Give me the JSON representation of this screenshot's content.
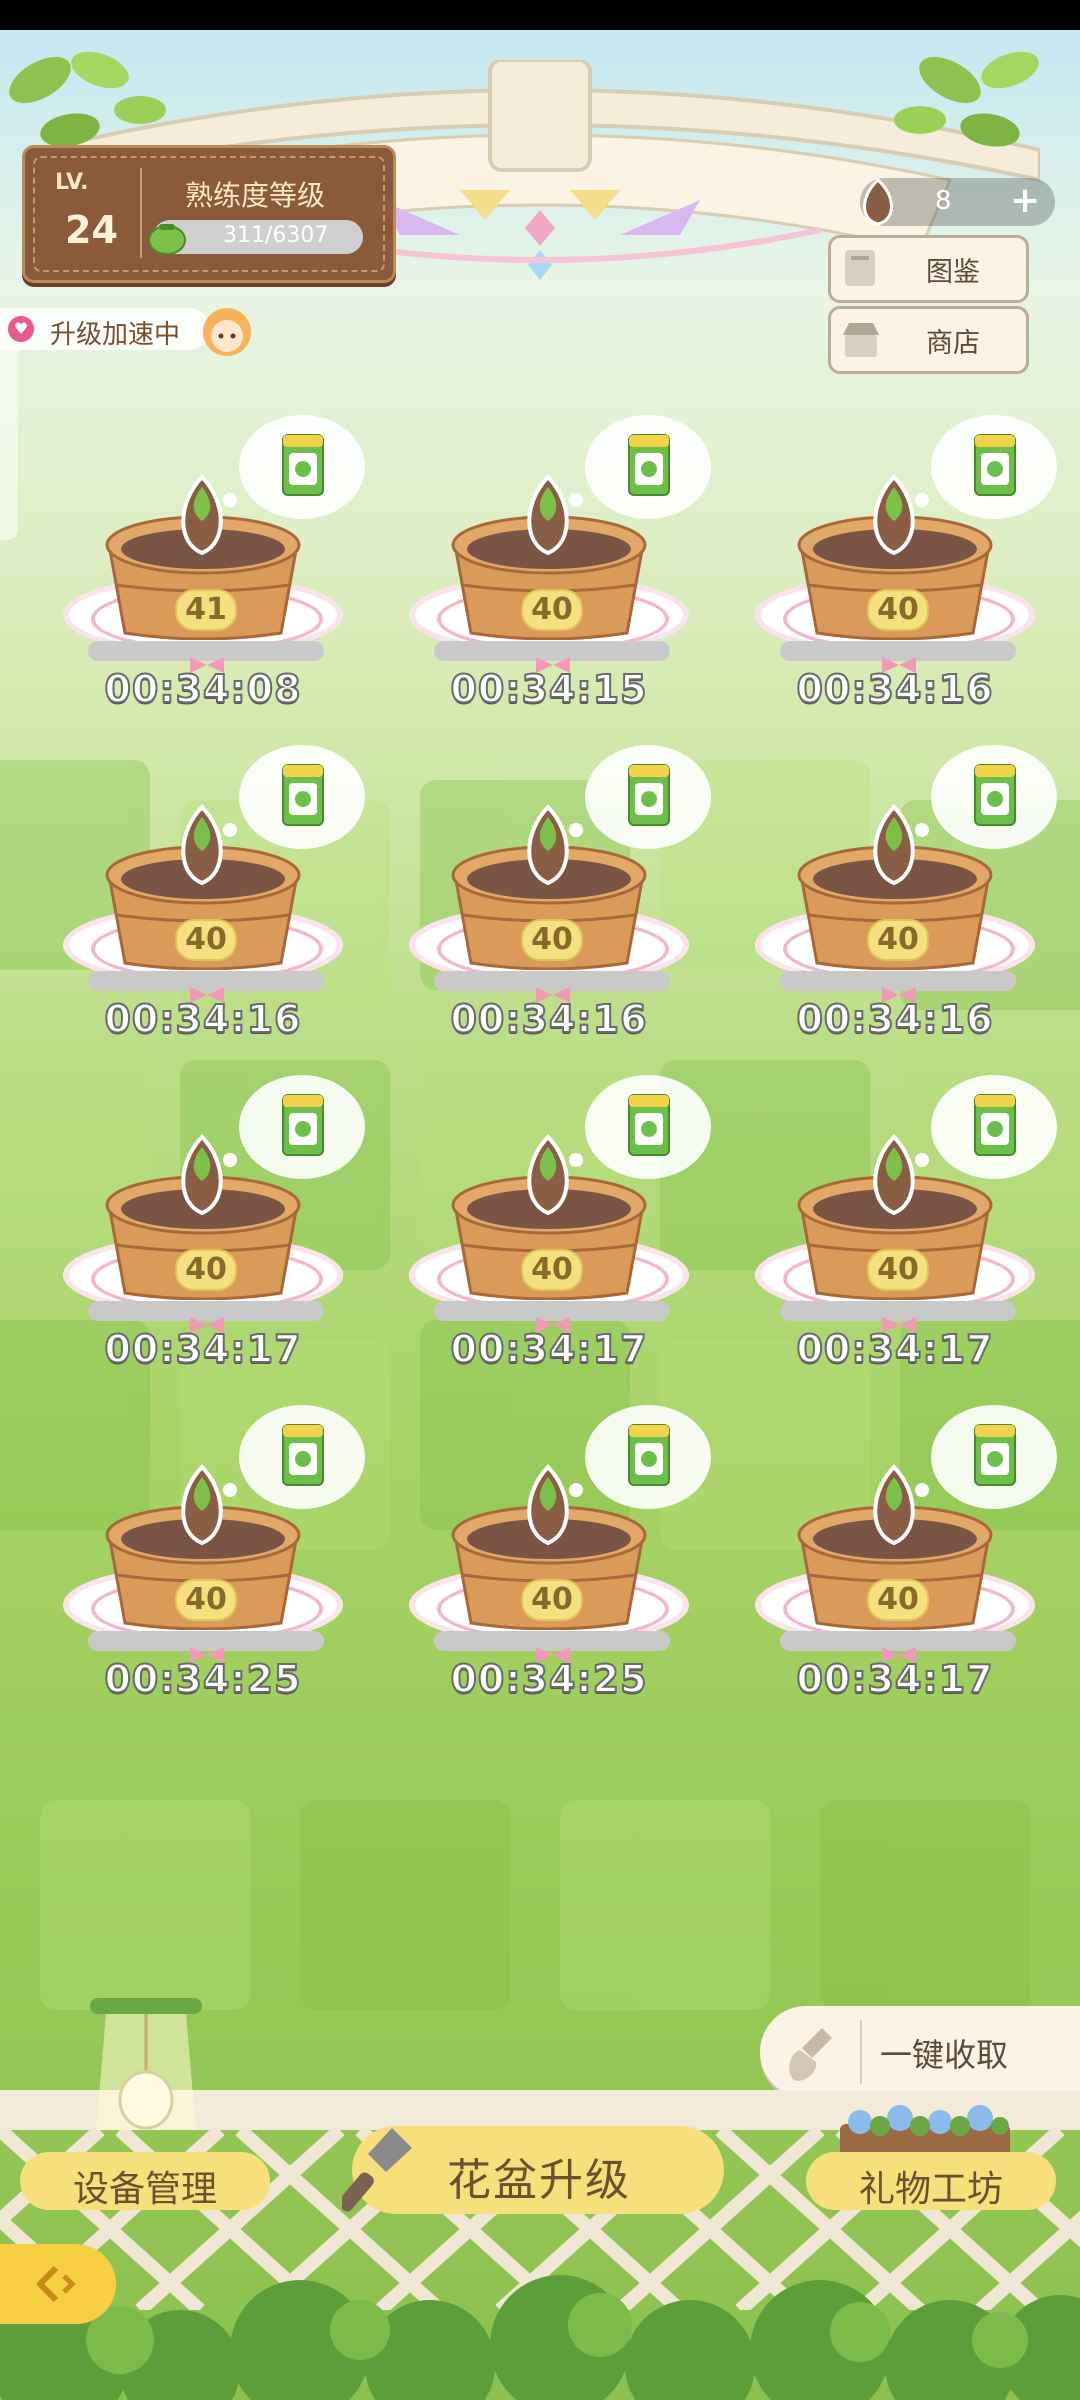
{
  "level_panel": {
    "lv_label": "LV.",
    "level": "24",
    "skill_title": "熟练度等级",
    "exp_text": "311/6307"
  },
  "speedup": {
    "label": "升级加速中"
  },
  "seed_counter": {
    "count": "8",
    "plus": "+"
  },
  "top_buttons": {
    "catalog": "图鉴",
    "shop": "商店"
  },
  "pots": [
    {
      "level": "41",
      "timer": "00:34:08"
    },
    {
      "level": "40",
      "timer": "00:34:15"
    },
    {
      "level": "40",
      "timer": "00:34:16"
    },
    {
      "level": "40",
      "timer": "00:34:16"
    },
    {
      "level": "40",
      "timer": "00:34:16"
    },
    {
      "level": "40",
      "timer": "00:34:16"
    },
    {
      "level": "40",
      "timer": "00:34:17"
    },
    {
      "level": "40",
      "timer": "00:34:17"
    },
    {
      "level": "40",
      "timer": "00:34:17"
    },
    {
      "level": "40",
      "timer": "00:34:25"
    },
    {
      "level": "40",
      "timer": "00:34:25"
    },
    {
      "level": "40",
      "timer": "00:34:17"
    }
  ],
  "collect_all": {
    "label": "一键收取"
  },
  "bottom_nav": {
    "device": "设备管理",
    "upgrade": "花盆升级",
    "gift": "礼物工坊"
  },
  "icons": {
    "collect": "shovel-icon",
    "upgrade": "trowel-icon",
    "back": "back-arrow-icon",
    "seed": "seed-packet-icon"
  }
}
